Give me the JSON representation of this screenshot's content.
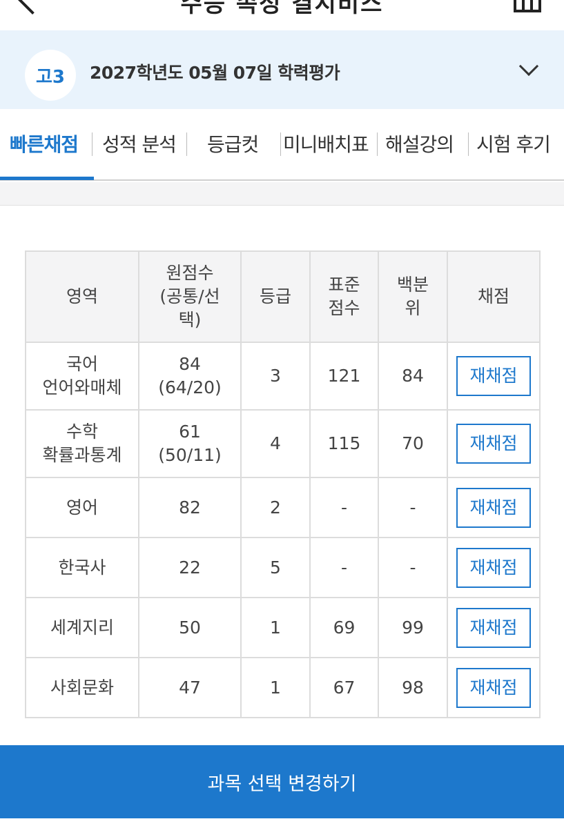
{
  "header": {
    "title": "수능 속성 결시비스",
    "back_icon": "chevron-left-icon",
    "home_icon": "home-icon"
  },
  "exam": {
    "grade_badge": "고3",
    "title": "2027학년도 05월 07일 학력평가",
    "dropdown_icon": "chevron-down-icon"
  },
  "tabs": [
    {
      "label": "빠른채점",
      "active": true
    },
    {
      "label": "성적 분석",
      "active": false
    },
    {
      "label": "등급컷",
      "active": false
    },
    {
      "label": "미니배치표",
      "active": false
    },
    {
      "label": "해설강의",
      "active": false
    },
    {
      "label": "시험 후기",
      "active": false
    }
  ],
  "table": {
    "headers": {
      "area": "영역",
      "raw_l1": "원점수",
      "raw_l2": "(공통/선",
      "raw_l3": "택)",
      "grade": "등급",
      "std_l1": "표준",
      "std_l2": "점수",
      "pct_l1": "백분",
      "pct_l2": "위",
      "score": "채점"
    },
    "rows": [
      {
        "area": "국어",
        "area_sub": "언어와매체",
        "raw": "84",
        "raw_sub": "(64/20)",
        "grade": "3",
        "std": "121",
        "pct": "84",
        "button": "재채점"
      },
      {
        "area": "수학",
        "area_sub": "확률과통계",
        "raw": "61",
        "raw_sub": "(50/11)",
        "grade": "4",
        "std": "115",
        "pct": "70",
        "button": "재채점"
      },
      {
        "area": "영어",
        "raw": "82",
        "grade": "2",
        "std": "-",
        "pct": "-",
        "button": "재채점"
      },
      {
        "area": "한국사",
        "raw": "22",
        "grade": "5",
        "std": "-",
        "pct": "-",
        "button": "재채점"
      },
      {
        "area": "세계지리",
        "raw": "50",
        "grade": "1",
        "std": "69",
        "pct": "99",
        "button": "재채점"
      },
      {
        "area": "사회문화",
        "raw": "47",
        "grade": "1",
        "std": "67",
        "pct": "98",
        "button": "재채점"
      }
    ]
  },
  "footer": {
    "button_label": "과목 선택 변경하기"
  },
  "colors": {
    "accent": "#1d78cc",
    "exam_bar_bg": "#e9f3fc",
    "header_cell_bg": "#f4f4f5"
  }
}
